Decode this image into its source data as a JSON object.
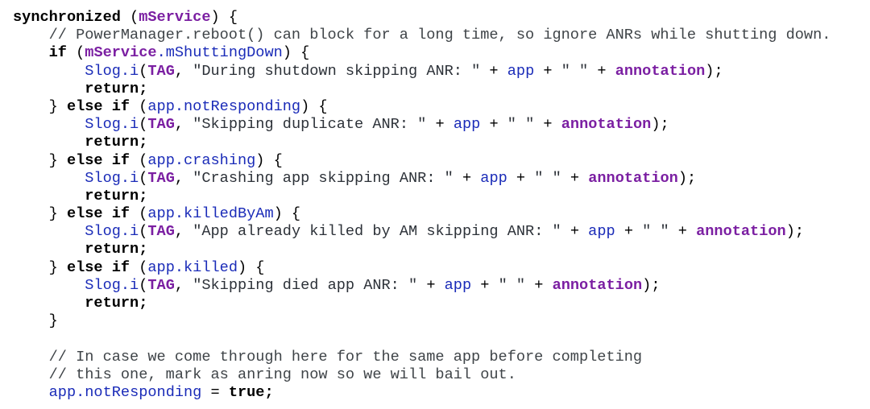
{
  "editor": {
    "lines": [
      {
        "tokens": [
          {
            "text": "synchronized",
            "kind": "kw"
          },
          {
            "text": " (",
            "kind": "plain"
          },
          {
            "text": "mService",
            "kind": "purple"
          },
          {
            "text": ") {",
            "kind": "plain"
          }
        ]
      },
      {
        "tokens": [
          {
            "text": "    // PowerManager.reboot() can block for a long time, so ignore ANRs while shutting down.",
            "kind": "cmt"
          }
        ]
      },
      {
        "tokens": [
          {
            "text": "    ",
            "kind": "plain"
          },
          {
            "text": "if",
            "kind": "kw"
          },
          {
            "text": " (",
            "kind": "plain"
          },
          {
            "text": "mService",
            "kind": "purple"
          },
          {
            "text": ".mShuttingDown",
            "kind": "blue"
          },
          {
            "text": ") {",
            "kind": "plain"
          }
        ]
      },
      {
        "tokens": [
          {
            "text": "        ",
            "kind": "plain"
          },
          {
            "text": "Slog.i",
            "kind": "blue"
          },
          {
            "text": "(",
            "kind": "plain"
          },
          {
            "text": "TAG",
            "kind": "purple"
          },
          {
            "text": ", ",
            "kind": "plain"
          },
          {
            "text": "\"During shutdown skipping ANR: \"",
            "kind": "str"
          },
          {
            "text": " + ",
            "kind": "plain"
          },
          {
            "text": "app",
            "kind": "blue"
          },
          {
            "text": " + ",
            "kind": "plain"
          },
          {
            "text": "\" \"",
            "kind": "str"
          },
          {
            "text": " + ",
            "kind": "plain"
          },
          {
            "text": "annotation",
            "kind": "purple"
          },
          {
            "text": ");",
            "kind": "plain"
          }
        ]
      },
      {
        "tokens": [
          {
            "text": "        ",
            "kind": "plain"
          },
          {
            "text": "return",
            "kind": "kw"
          },
          {
            "text": ";",
            "kind": "kw"
          }
        ]
      },
      {
        "tokens": [
          {
            "text": "    } ",
            "kind": "plain"
          },
          {
            "text": "else if",
            "kind": "kw"
          },
          {
            "text": " (",
            "kind": "plain"
          },
          {
            "text": "app.notResponding",
            "kind": "blue"
          },
          {
            "text": ") {",
            "kind": "plain"
          }
        ]
      },
      {
        "tokens": [
          {
            "text": "        ",
            "kind": "plain"
          },
          {
            "text": "Slog.i",
            "kind": "blue"
          },
          {
            "text": "(",
            "kind": "plain"
          },
          {
            "text": "TAG",
            "kind": "purple"
          },
          {
            "text": ", ",
            "kind": "plain"
          },
          {
            "text": "\"Skipping duplicate ANR: \"",
            "kind": "str"
          },
          {
            "text": " + ",
            "kind": "plain"
          },
          {
            "text": "app",
            "kind": "blue"
          },
          {
            "text": " + ",
            "kind": "plain"
          },
          {
            "text": "\" \"",
            "kind": "str"
          },
          {
            "text": " + ",
            "kind": "plain"
          },
          {
            "text": "annotation",
            "kind": "purple"
          },
          {
            "text": ");",
            "kind": "plain"
          }
        ]
      },
      {
        "tokens": [
          {
            "text": "        ",
            "kind": "plain"
          },
          {
            "text": "return",
            "kind": "kw"
          },
          {
            "text": ";",
            "kind": "kw"
          }
        ]
      },
      {
        "tokens": [
          {
            "text": "    } ",
            "kind": "plain"
          },
          {
            "text": "else if",
            "kind": "kw"
          },
          {
            "text": " (",
            "kind": "plain"
          },
          {
            "text": "app.crashing",
            "kind": "blue"
          },
          {
            "text": ") {",
            "kind": "plain"
          }
        ]
      },
      {
        "tokens": [
          {
            "text": "        ",
            "kind": "plain"
          },
          {
            "text": "Slog.i",
            "kind": "blue"
          },
          {
            "text": "(",
            "kind": "plain"
          },
          {
            "text": "TAG",
            "kind": "purple"
          },
          {
            "text": ", ",
            "kind": "plain"
          },
          {
            "text": "\"Crashing app skipping ANR: \"",
            "kind": "str"
          },
          {
            "text": " + ",
            "kind": "plain"
          },
          {
            "text": "app",
            "kind": "blue"
          },
          {
            "text": " + ",
            "kind": "plain"
          },
          {
            "text": "\" \"",
            "kind": "str"
          },
          {
            "text": " + ",
            "kind": "plain"
          },
          {
            "text": "annotation",
            "kind": "purple"
          },
          {
            "text": ");",
            "kind": "plain"
          }
        ]
      },
      {
        "tokens": [
          {
            "text": "        ",
            "kind": "plain"
          },
          {
            "text": "return",
            "kind": "kw"
          },
          {
            "text": ";",
            "kind": "kw"
          }
        ]
      },
      {
        "tokens": [
          {
            "text": "    } ",
            "kind": "plain"
          },
          {
            "text": "else if",
            "kind": "kw"
          },
          {
            "text": " (",
            "kind": "plain"
          },
          {
            "text": "app.killedByAm",
            "kind": "blue"
          },
          {
            "text": ") {",
            "kind": "plain"
          }
        ]
      },
      {
        "tokens": [
          {
            "text": "        ",
            "kind": "plain"
          },
          {
            "text": "Slog.i",
            "kind": "blue"
          },
          {
            "text": "(",
            "kind": "plain"
          },
          {
            "text": "TAG",
            "kind": "purple"
          },
          {
            "text": ", ",
            "kind": "plain"
          },
          {
            "text": "\"App already killed by AM skipping ANR: \"",
            "kind": "str"
          },
          {
            "text": " + ",
            "kind": "plain"
          },
          {
            "text": "app",
            "kind": "blue"
          },
          {
            "text": " + ",
            "kind": "plain"
          },
          {
            "text": "\" \"",
            "kind": "str"
          },
          {
            "text": " + ",
            "kind": "plain"
          },
          {
            "text": "annotation",
            "kind": "purple"
          },
          {
            "text": ");",
            "kind": "plain"
          }
        ]
      },
      {
        "tokens": [
          {
            "text": "        ",
            "kind": "plain"
          },
          {
            "text": "return",
            "kind": "kw"
          },
          {
            "text": ";",
            "kind": "kw"
          }
        ]
      },
      {
        "tokens": [
          {
            "text": "    } ",
            "kind": "plain"
          },
          {
            "text": "else if",
            "kind": "kw"
          },
          {
            "text": " (",
            "kind": "plain"
          },
          {
            "text": "app.killed",
            "kind": "blue"
          },
          {
            "text": ") {",
            "kind": "plain"
          }
        ]
      },
      {
        "tokens": [
          {
            "text": "        ",
            "kind": "plain"
          },
          {
            "text": "Slog.i",
            "kind": "blue"
          },
          {
            "text": "(",
            "kind": "plain"
          },
          {
            "text": "TAG",
            "kind": "purple"
          },
          {
            "text": ", ",
            "kind": "plain"
          },
          {
            "text": "\"Skipping died app ANR: \"",
            "kind": "str"
          },
          {
            "text": " + ",
            "kind": "plain"
          },
          {
            "text": "app",
            "kind": "blue"
          },
          {
            "text": " + ",
            "kind": "plain"
          },
          {
            "text": "\" \"",
            "kind": "str"
          },
          {
            "text": " + ",
            "kind": "plain"
          },
          {
            "text": "annotation",
            "kind": "purple"
          },
          {
            "text": ");",
            "kind": "plain"
          }
        ]
      },
      {
        "tokens": [
          {
            "text": "        ",
            "kind": "plain"
          },
          {
            "text": "return",
            "kind": "kw"
          },
          {
            "text": ";",
            "kind": "kw"
          }
        ]
      },
      {
        "tokens": [
          {
            "text": "    }",
            "kind": "plain"
          }
        ]
      },
      {
        "tokens": []
      },
      {
        "tokens": [
          {
            "text": "    // In case we come through here for the same app before completing",
            "kind": "cmt"
          }
        ]
      },
      {
        "tokens": [
          {
            "text": "    // this one, mark as anring now so we will bail out.",
            "kind": "cmt"
          }
        ]
      },
      {
        "tokens": [
          {
            "text": "    ",
            "kind": "plain"
          },
          {
            "text": "app.notResponding",
            "kind": "blue"
          },
          {
            "text": " = ",
            "kind": "plain"
          },
          {
            "text": "true",
            "kind": "kw"
          },
          {
            "text": ";",
            "kind": "kw"
          }
        ]
      }
    ]
  }
}
